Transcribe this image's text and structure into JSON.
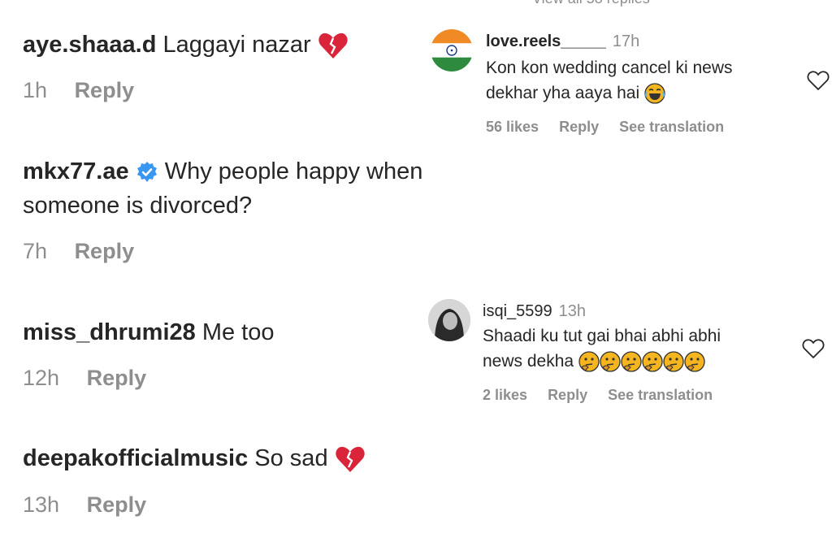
{
  "top_cut_text": "View all 58 replies",
  "left_comments": [
    {
      "username": "aye.shaaa.d",
      "text": "Laggayi nazar",
      "time": "1h",
      "reply_label": "Reply"
    },
    {
      "username": "mkx77.ae",
      "verified": true,
      "text_line1": "Why people happy when",
      "text_line2": "someone is divorced?",
      "time": "7h",
      "reply_label": "Reply"
    },
    {
      "username": "miss_dhrumi28",
      "text": "Me too",
      "time": "12h",
      "reply_label": "Reply"
    },
    {
      "username": "deepakofficialmusic",
      "text": "So sad",
      "time": "13h",
      "reply_label": "Reply"
    }
  ],
  "right_comments": [
    {
      "username": "love.reels_____",
      "time": "17h",
      "line1": "Kon kon wedding cancel ki news",
      "line2": "dekhar yha aaya hai",
      "likes": "56 likes",
      "reply_label": "Reply",
      "translation_label": "See translation",
      "avatar": "india-flag-avatar"
    },
    {
      "username": "isqi_5599",
      "time": "13h",
      "line1": "Shaadi ku tut gai bhai abhi abhi",
      "line2": "news dekha",
      "likes": "2 likes",
      "reply_label": "Reply",
      "translation_label": "See translation",
      "avatar": "grayscale-portrait-avatar"
    }
  ],
  "colors": {
    "text": "#262626",
    "muted": "#8e8e8e",
    "verified": "#3897f0",
    "broken_heart": "#d9243a",
    "emoji_yellow": "#f5b51f"
  }
}
